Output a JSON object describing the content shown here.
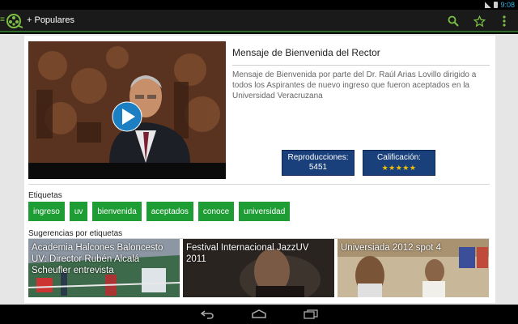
{
  "status_bar": {
    "time": "9:08"
  },
  "action_bar": {
    "title": "+ Populares",
    "icons": [
      "up-caret-icon",
      "film-reel-logo",
      "search-icon",
      "star-icon",
      "overflow-menu-icon"
    ],
    "accent": "#7bc043"
  },
  "video": {
    "title": "Mensaje de Bienvenida del Rector",
    "description": "Mensaje de Bienvenida por parte del Dr. Raúl Arias Lovillo dirigido a todos los Aspirantes de nuevo ingreso que fueron aceptados en la Universidad Veracruzana",
    "views_label": "Reproducciones:",
    "views_value": "5451",
    "rating_label": "Calificación:",
    "rating_stars": "★★★★★",
    "play_icon": "play-icon"
  },
  "tags": {
    "label": "Etiquetas",
    "items": [
      "ingreso",
      "uv",
      "bienvenida",
      "aceptados",
      "conoce",
      "universidad"
    ],
    "color": "#1f9d35"
  },
  "suggestions": {
    "label": "Sugerencias por etiquetas",
    "items": [
      {
        "title": "Academia Halcones Baloncesto UV: Director Rubén Alcalá Scheufler entrevista"
      },
      {
        "title": "Festival Internacional JazzUV 2011"
      },
      {
        "title": "Universiada 2012 spot 4"
      }
    ]
  },
  "nav_bar": {
    "icons": [
      "back-icon",
      "home-icon",
      "recent-apps-icon"
    ]
  },
  "colors": {
    "stat_bg": "#19407a",
    "play_blue": "#1c7fc4"
  }
}
